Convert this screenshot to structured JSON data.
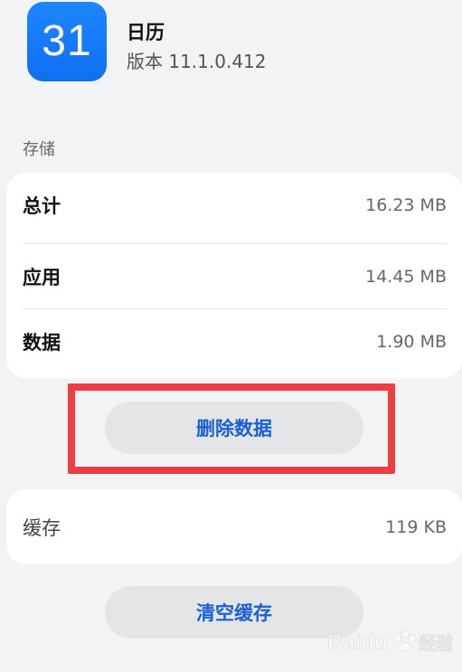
{
  "app": {
    "icon_text": "31",
    "name": "日历",
    "version": "版本 11.1.0.412"
  },
  "storage": {
    "section_title": "存储",
    "rows": [
      {
        "label": "总计",
        "value": "16.23 MB"
      },
      {
        "label": "应用",
        "value": "14.45 MB"
      },
      {
        "label": "数据",
        "value": "1.90 MB"
      }
    ],
    "delete_button": "删除数据"
  },
  "cache": {
    "label": "缓存",
    "value": "119 KB",
    "clear_button": "清空缓存"
  },
  "watermark": {
    "brand": "Baidu",
    "suffix": "经验"
  },
  "colors": {
    "page_background": "#f1f3f5",
    "card_background": "#ffffff",
    "icon_blue": "#1f86ff",
    "button_background": "#e4e5e7",
    "button_text": "#1c5fd2",
    "highlight": "#ef3e42"
  }
}
